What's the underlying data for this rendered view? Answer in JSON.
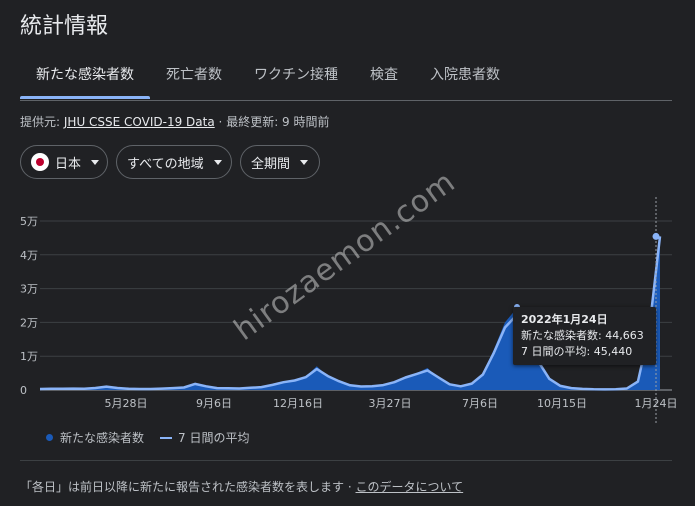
{
  "header": {
    "title": "統計情報"
  },
  "tabs": [
    {
      "label": "新たな感染者数",
      "active": true
    },
    {
      "label": "死亡者数"
    },
    {
      "label": "ワクチン接種"
    },
    {
      "label": "検査"
    },
    {
      "label": "入院患者数"
    }
  ],
  "source": {
    "prefix": "提供元:",
    "link": "JHU CSSE COVID-19 Data",
    "separator": "·",
    "updated": "最終更新: 9 時間前"
  },
  "filters": {
    "country": "日本",
    "region": "すべての地域",
    "period": "全期間"
  },
  "chart_data": {
    "type": "area",
    "x_ticks": [
      "5月28日",
      "9月6日",
      "12月16日",
      "3月27日",
      "7月6日",
      "10月15日",
      "1月24日"
    ],
    "y_ticks": [
      "0",
      "1万",
      "2万",
      "3万",
      "4万",
      "5万"
    ],
    "ylim": [
      0,
      50000
    ],
    "grid": true,
    "legend": "bottom-left",
    "series": [
      {
        "name": "新たな感染者数",
        "kind": "bar",
        "color": "#1a5ab8",
        "values": [
          300,
          400,
          300,
          500,
          300,
          700,
          1200,
          500,
          300,
          300,
          300,
          400,
          600,
          800,
          2100,
          1000,
          500,
          500,
          400,
          700,
          900,
          1600,
          2500,
          3000,
          4000,
          7000,
          4000,
          2500,
          1200,
          1000,
          1100,
          1500,
          2500,
          4000,
          5000,
          6500,
          3500,
          1500,
          1000,
          2000,
          5000,
          12000,
          20000,
          24000,
          18000,
          8000,
          3000,
          1000,
          500,
          300,
          200,
          150,
          200,
          500,
          3000,
          20000,
          44663
        ]
      },
      {
        "name": "7 日間の平均",
        "kind": "line",
        "color": "#8ab4f8",
        "values": [
          300,
          350,
          350,
          400,
          350,
          600,
          1000,
          600,
          350,
          300,
          300,
          400,
          550,
          750,
          1800,
          1100,
          550,
          500,
          450,
          650,
          850,
          1500,
          2300,
          2800,
          3800,
          6200,
          4100,
          2600,
          1400,
          1050,
          1100,
          1450,
          2300,
          3700,
          4700,
          5800,
          3700,
          1700,
          1100,
          1900,
          4600,
          11000,
          18500,
          22000,
          17000,
          8500,
          3300,
          1200,
          550,
          320,
          220,
          170,
          200,
          450,
          2500,
          17000,
          45440
        ]
      }
    ]
  },
  "legend": {
    "cases": "新たな感染者数",
    "avg": "7 日間の平均"
  },
  "tooltip": {
    "date": "2022年1月24日",
    "cases": "新たな感染者数: 44,663",
    "avg": "7 日間の平均: 45,440"
  },
  "footer": {
    "note": "「各日」は前日以降に新たに報告された感染者数を表します",
    "separator": "·",
    "link": "このデータについて"
  },
  "watermark": "hirozaemon.com"
}
